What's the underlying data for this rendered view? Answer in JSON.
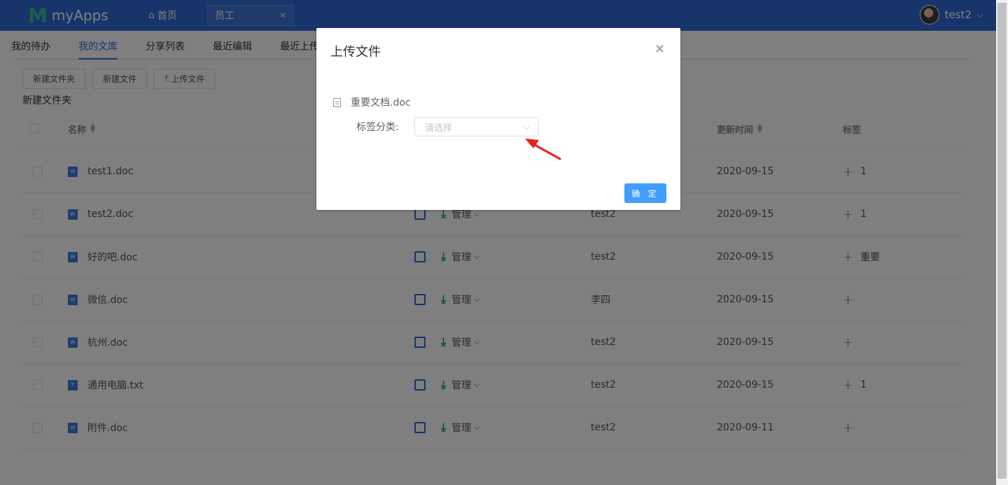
{
  "header": {
    "app_logo_letter": "M",
    "app_name": "myApps",
    "home_label": "首页",
    "open_tab": "员工",
    "user_name": "test2",
    "brand_color": "#2f6ad6"
  },
  "subtabs": [
    {
      "label": "我的待办",
      "active": false
    },
    {
      "label": "我的文库",
      "active": true
    },
    {
      "label": "分享列表",
      "active": false
    },
    {
      "label": "最近编辑",
      "active": false
    },
    {
      "label": "最近上传",
      "active": false
    }
  ],
  "toolbar": {
    "new_folder": "新建文件夹",
    "new_file": "新建文件",
    "upload": "上传文件"
  },
  "breadcrumb": "新建文件夹",
  "table": {
    "headers": {
      "name": "名称",
      "updated": "更新时间",
      "tag": "标签"
    },
    "manage_label": "管理",
    "rows": [
      {
        "name": "test1.doc",
        "type": "W",
        "owner": "",
        "updated": "2020-09-15",
        "tag": "1"
      },
      {
        "name": "test2.doc",
        "type": "W",
        "owner": "test2",
        "updated": "2020-09-15",
        "tag": "1"
      },
      {
        "name": "好的吧.doc",
        "type": "W",
        "owner": "test2",
        "updated": "2020-09-15",
        "tag": "重要"
      },
      {
        "name": "微信.doc",
        "type": "W",
        "owner": "李四",
        "updated": "2020-09-15",
        "tag": ""
      },
      {
        "name": "杭州.doc",
        "type": "W",
        "owner": "test2",
        "updated": "2020-09-15",
        "tag": ""
      },
      {
        "name": "通用电脑.txt",
        "type": "T",
        "owner": "test2",
        "updated": "2020-09-15",
        "tag": "1"
      },
      {
        "name": "附件.doc",
        "type": "W",
        "owner": "test2",
        "updated": "2020-09-11",
        "tag": ""
      }
    ]
  },
  "dialog": {
    "title": "上传文件",
    "file_name": "重要文档.doc",
    "tag_label": "标签分类:",
    "select_placeholder": "请选择",
    "confirm": "确 定"
  }
}
